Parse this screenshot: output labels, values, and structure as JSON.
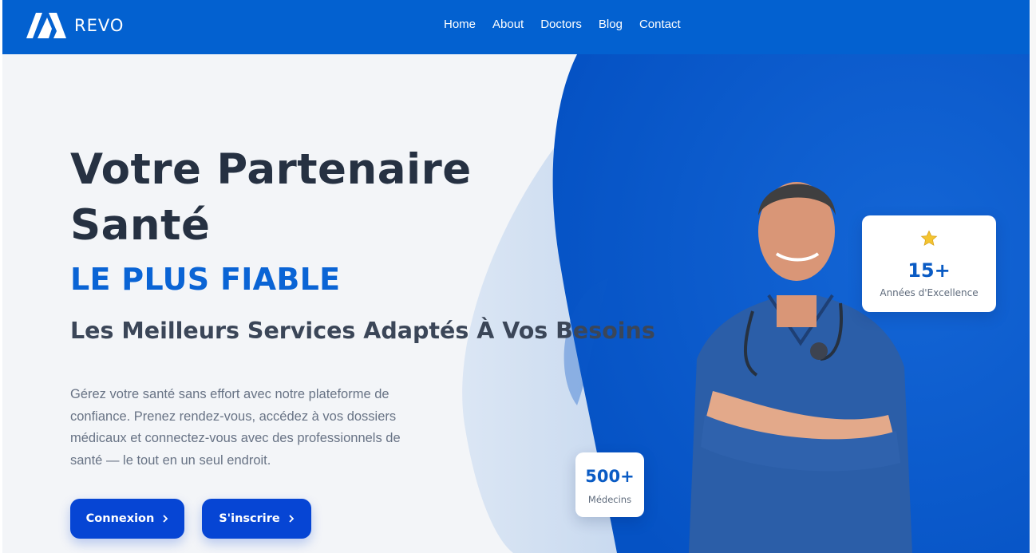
{
  "brand": {
    "name": "REVO",
    "logo_icon": "revo-logo-icon"
  },
  "nav": {
    "items": [
      "Home",
      "About",
      "Doctors",
      "Blog",
      "Contact"
    ]
  },
  "hero": {
    "headline": "Votre Partenaire Santé",
    "accent": "LE PLUS FIABLE",
    "subheadline": "Les Meilleurs Services Adaptés À Vos Besoins",
    "description": "Gérez votre santé sans effort avec notre plateforme de confiance. Prenez rendez-vous, accédez à vos dossiers médicaux et connectez-vous avec des professionnels de santé — le tout en un seul endroit.",
    "buttons": {
      "login": "Connexion",
      "signup": "S'inscrire"
    }
  },
  "stats": {
    "years": {
      "value": "15+",
      "label": "Années d'Excellence",
      "icon": "star-icon"
    },
    "doctors": {
      "value": "500+",
      "label": "Médecins"
    }
  },
  "colors": {
    "primary": "#0361d0",
    "accent_text": "#0a64d5",
    "heading": "#263142",
    "button": "#0645d4",
    "hero_blue": "#0a5bcc"
  }
}
